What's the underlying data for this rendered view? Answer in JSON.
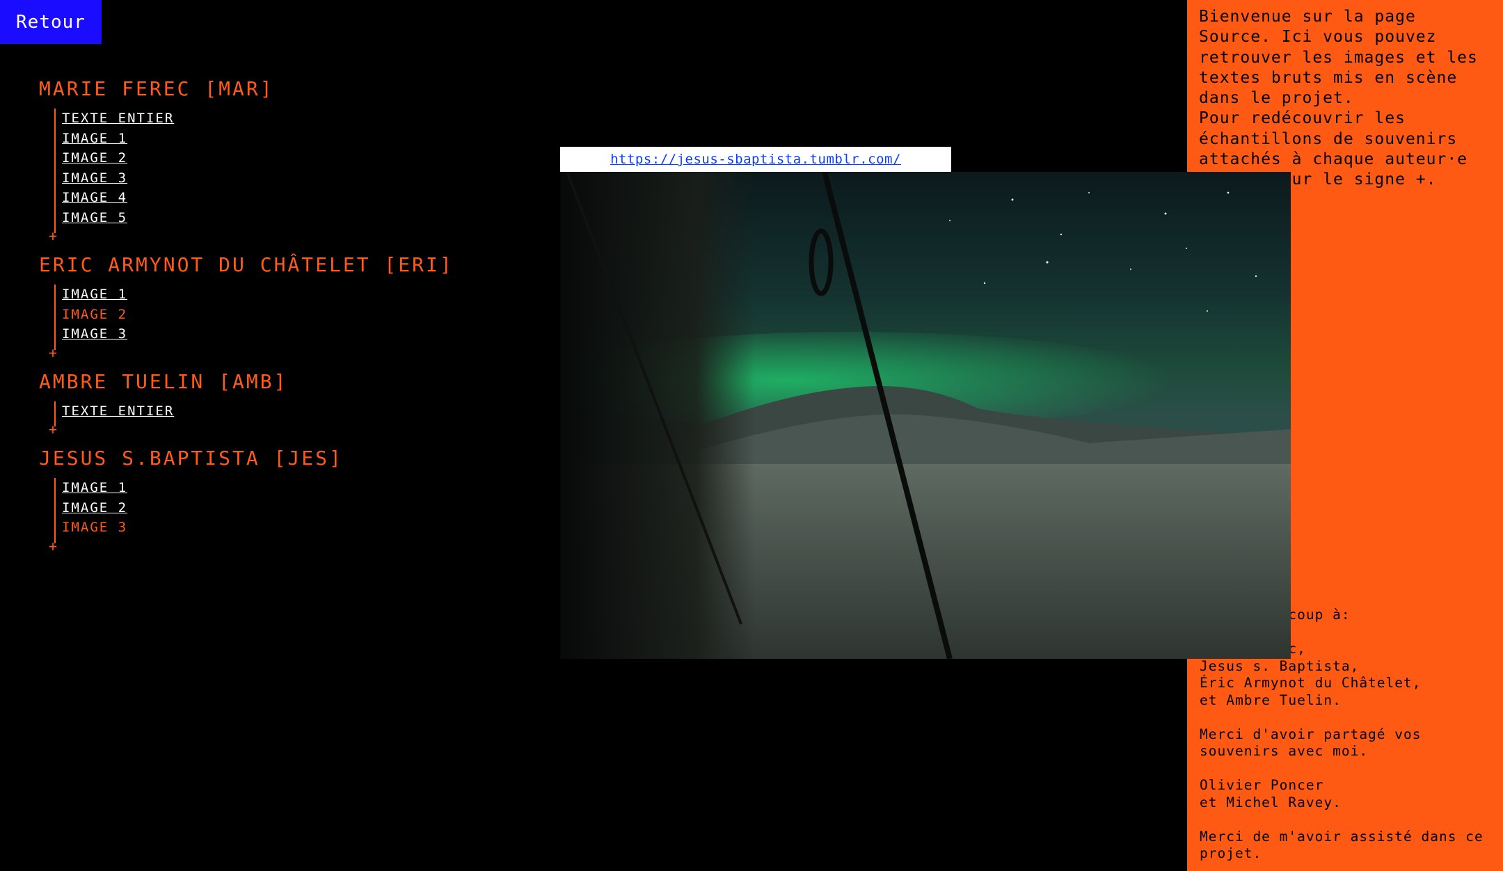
{
  "nav": {
    "back_label": "Retour"
  },
  "authors": [
    {
      "name": "Marie Ferec [MAR]",
      "items": [
        {
          "label": "Texte entier",
          "active": false
        },
        {
          "label": "Image 1",
          "active": false
        },
        {
          "label": "Image 2",
          "active": false
        },
        {
          "label": "Image 3",
          "active": false
        },
        {
          "label": "Image 4",
          "active": false
        },
        {
          "label": "Image 5",
          "active": false
        }
      ]
    },
    {
      "name": "Eric Armynot du Châtelet [ERI]",
      "items": [
        {
          "label": "Image 1",
          "active": false
        },
        {
          "label": "Image 2",
          "active": true
        },
        {
          "label": "Image 3",
          "active": false
        }
      ]
    },
    {
      "name": "Ambre Tuelin [AMB]",
      "items": [
        {
          "label": "Texte entier",
          "active": false
        }
      ]
    },
    {
      "name": "Jesus S.Baptista [JES]",
      "items": [
        {
          "label": "Image 1",
          "active": false
        },
        {
          "label": "Image 2",
          "active": false
        },
        {
          "label": "Image 3",
          "active": true
        }
      ]
    }
  ],
  "expand_symbol": "+",
  "viewer": {
    "url": "https://jesus-sbaptista.tumblr.com/"
  },
  "panel": {
    "intro": "Bienvenue sur la page Source. Ici vous pouvez retrouver les images et les textes bruts mis en scène dans le projet.\nPour redécouvrir les échantillons de souvenirs attachés à chaque auteur·e cliquez sur le signe +.",
    "thanks": "Merci beaucoup à:\n\nMarie Ferec,\nJesus s. Baptista,\nÉric Armynot du Châtelet,\net Ambre Tuelin.\n\nMerci d'avoir partagé vos souvenirs avec moi.\n\nOlivier Poncer\net Michel Ravey.\n\nMerci de m'avoir assisté dans ce projet."
  },
  "colors": {
    "accent": "#ff5a1a",
    "button": "#1a0dff",
    "background": "#000000",
    "panel": "#ff5a14"
  }
}
